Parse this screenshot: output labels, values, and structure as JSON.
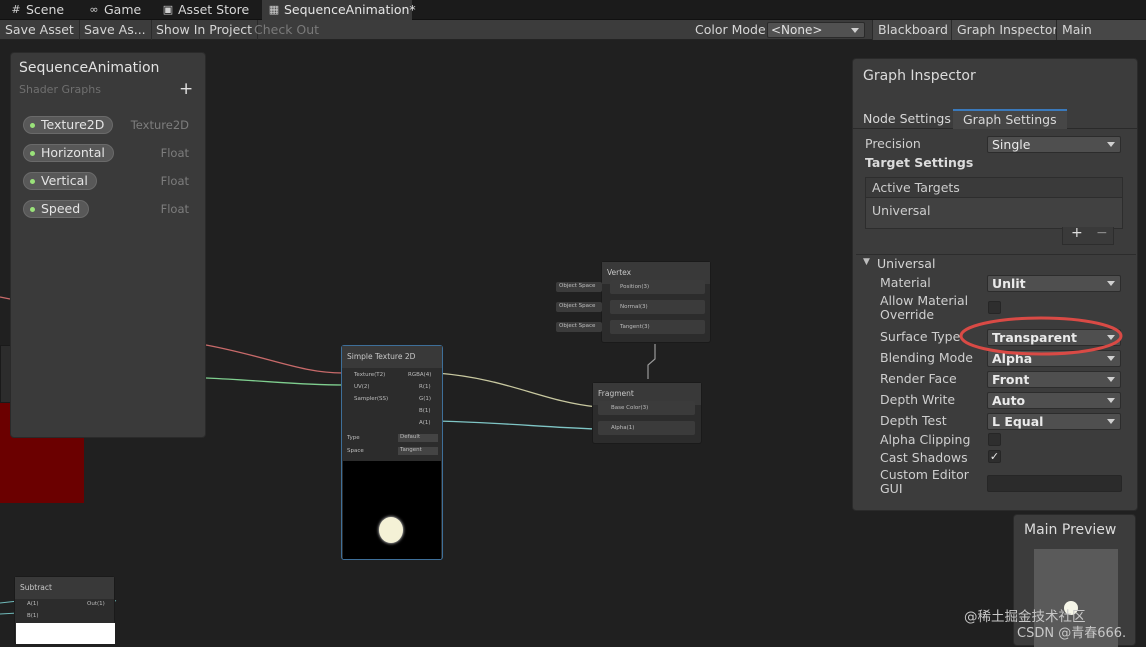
{
  "tabs": [
    {
      "label": "Scene",
      "icon": "scene-icon",
      "glyph": "#"
    },
    {
      "label": "Game",
      "icon": "gamepad-icon",
      "glyph": "∞"
    },
    {
      "label": "Asset Store",
      "icon": "store-bag-icon",
      "glyph": "▣"
    },
    {
      "label": "SequenceAnimation*",
      "icon": "shader-graph-icon",
      "glyph": "▦"
    }
  ],
  "toolbar": {
    "save_asset": "Save Asset",
    "save_as": "Save As...",
    "show_in_project": "Show In Project",
    "check_out": "Check Out",
    "color_mode_label": "Color Mode",
    "color_mode_value": "<None>",
    "blackboard": "Blackboard",
    "graph_inspector": "Graph Inspector",
    "main_preview": "Main Preview"
  },
  "blackboard": {
    "title": "SequenceAnimation",
    "subtitle": "Shader Graphs",
    "add": "+",
    "properties": [
      {
        "name": "Texture2D",
        "type": "Texture2D"
      },
      {
        "name": "Horizontal",
        "type": "Float"
      },
      {
        "name": "Vertical",
        "type": "Float"
      },
      {
        "name": "Speed",
        "type": "Float"
      }
    ]
  },
  "inspector": {
    "title": "Graph Inspector",
    "tabs": [
      "Node Settings",
      "Graph Settings"
    ],
    "precision_label": "Precision",
    "precision_value": "Single",
    "target_settings": "Target Settings",
    "active_targets": "Active Targets",
    "target_item": "Universal",
    "add_btn": "+",
    "remove_btn": "−",
    "section": "Universal",
    "rows": [
      {
        "label": "Material",
        "value": "Unlit"
      },
      {
        "label": "Allow Material Override",
        "value": ""
      },
      {
        "label": "Surface Type",
        "value": "Transparent"
      },
      {
        "label": "Blending Mode",
        "value": "Alpha"
      },
      {
        "label": "Render Face",
        "value": "Front"
      },
      {
        "label": "Depth Write",
        "value": "Auto"
      },
      {
        "label": "Depth Test",
        "value": "L Equal"
      },
      {
        "label": "Alpha Clipping",
        "value": ""
      },
      {
        "label": "Cast Shadows",
        "value": "✓"
      },
      {
        "label": "Custom Editor GUI",
        "value": ""
      }
    ]
  },
  "preview": {
    "title": "Main Preview"
  },
  "nodes": {
    "vertex": {
      "title": "Vertex",
      "ports": [
        "Position(3)",
        "Normal(3)",
        "Tangent(3)"
      ],
      "space": "Object Space"
    },
    "fragment": {
      "title": "Fragment",
      "ports": [
        "Base Color(3)",
        "Alpha(1)"
      ]
    },
    "sample": {
      "title": "Simple Texture 2D",
      "inputs": [
        "Texture(T2)",
        "UV(2)",
        "Sampler(SS)"
      ],
      "outputs": [
        "RGBA(4)",
        "R(1)",
        "G(1)",
        "B(1)",
        "A(1)"
      ],
      "type_label": "Type",
      "type_value": "Default",
      "space_label": "Space",
      "space_value": "Tangent"
    },
    "subtract": {
      "title": "Subtract",
      "inputs": [
        "A(1)",
        "B(1)"
      ],
      "output": "Out(1)"
    }
  },
  "watermark": {
    "line1": "@稀土掘金技术社区",
    "line2": "CSDN @青春666."
  },
  "colors": {
    "highlight": "#d94a45",
    "accent": "#3a79bb"
  }
}
